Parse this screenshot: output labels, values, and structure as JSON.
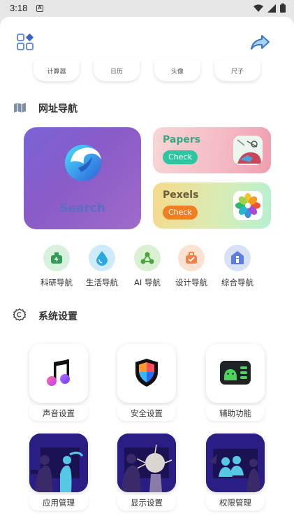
{
  "statusbar": {
    "time": "3:18",
    "notification_glyph": "A",
    "icons": [
      "wifi-icon",
      "signal-icon",
      "battery-icon"
    ]
  },
  "topbar": {
    "left_icon": "apps-grid-icon",
    "right_icon": "share-icon"
  },
  "tools_row": {
    "items": [
      "计算器",
      "日历",
      "头像",
      "尺子"
    ]
  },
  "url_nav": {
    "title": "网址导航",
    "search_card": {
      "label": "Search"
    },
    "papers_card": {
      "title": "Papers",
      "button": "Check",
      "title_color": "#3aa885",
      "button_color": "#2ec6a1"
    },
    "pexels_card": {
      "title": "Pexels",
      "button": "Check",
      "title_color": "#6b5a3a",
      "button_color": "#f07f22"
    },
    "nav_items": [
      {
        "label": "科研导航",
        "icon": "flask-icon",
        "color": "#5ac77a"
      },
      {
        "label": "生活导航",
        "icon": "water-drop-icon",
        "color": "#43b7e7"
      },
      {
        "label": "AI 导航",
        "icon": "network-icon",
        "color": "#73c85a"
      },
      {
        "label": "设计导航",
        "icon": "toolbox-icon",
        "color": "#f29a5a"
      },
      {
        "label": "综合导航",
        "icon": "home-icon",
        "color": "#6f8be8"
      }
    ]
  },
  "system_settings": {
    "title": "系统设置",
    "tiles": [
      {
        "label": "声音设置",
        "icon": "music-note-icon"
      },
      {
        "label": "安全设置",
        "icon": "shield-icon"
      },
      {
        "label": "辅助功能",
        "icon": "android-icon"
      },
      {
        "label": "应用管理",
        "icon": "apps-illustration"
      },
      {
        "label": "显示设置",
        "icon": "display-illustration"
      },
      {
        "label": "权限管理",
        "icon": "permissions-illustration"
      }
    ]
  }
}
